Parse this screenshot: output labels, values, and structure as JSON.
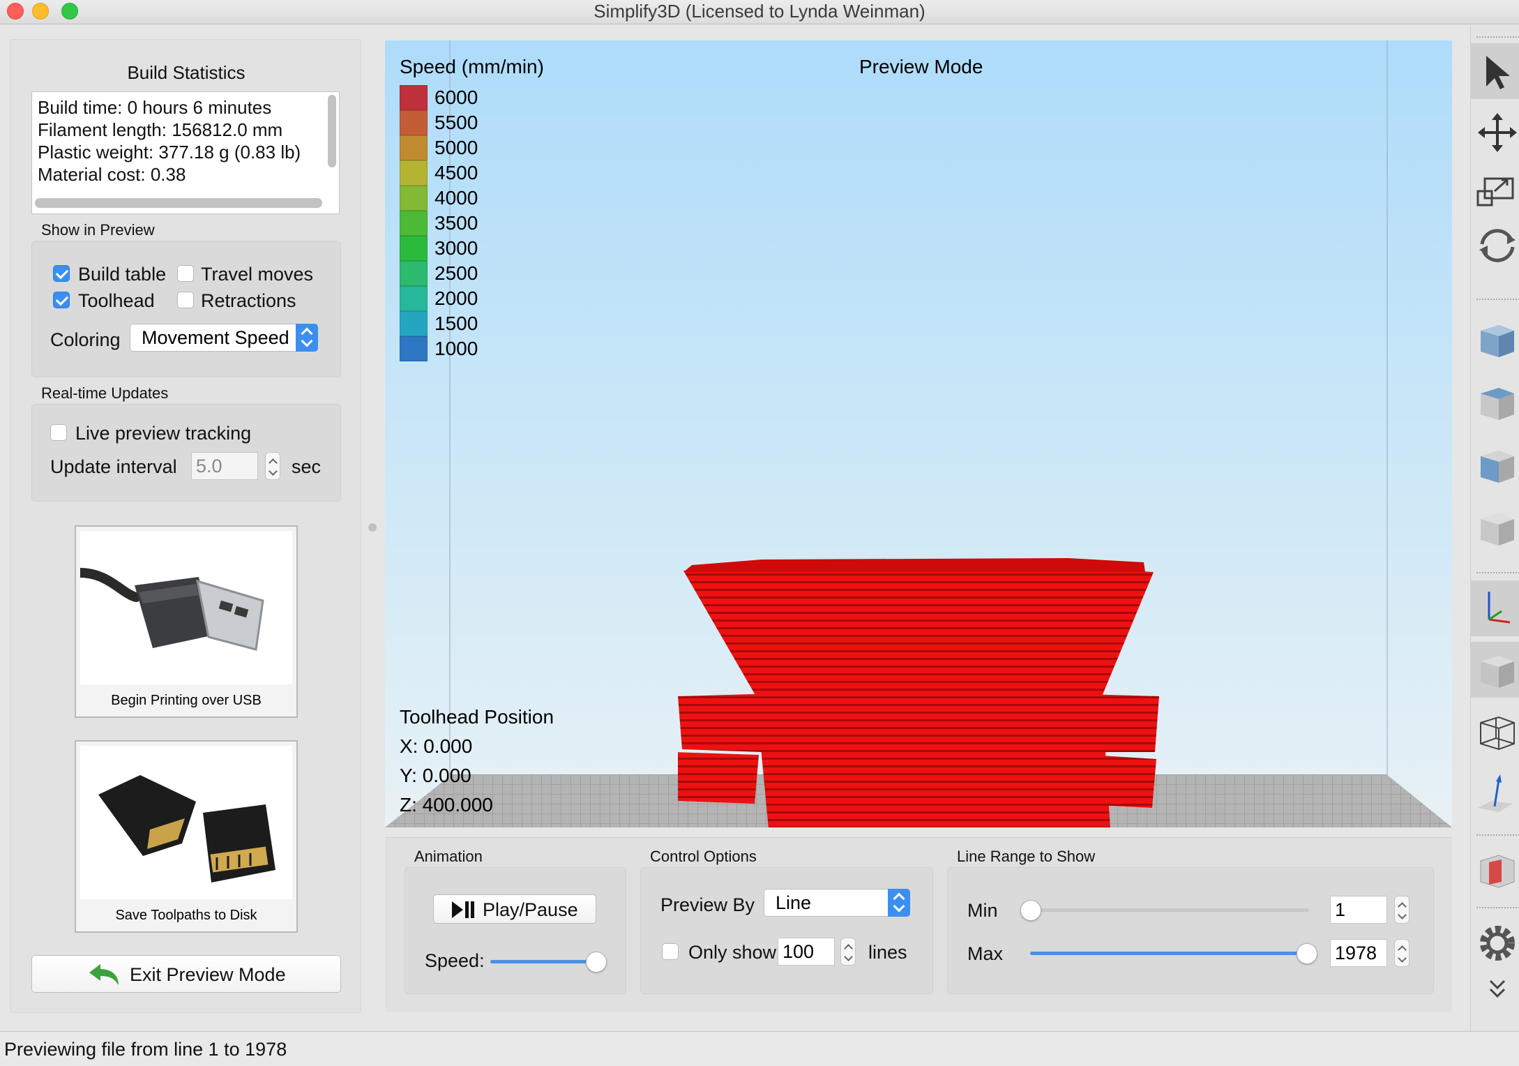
{
  "window": {
    "title": "Simplify3D (Licensed to Lynda Weinman)"
  },
  "build_stats": {
    "heading": "Build Statistics",
    "lines": [
      "Build time: 0 hours 6 minutes",
      "Filament length: 156812.0 mm",
      "Plastic weight: 377.18 g (0.83 lb)",
      "Material cost: 0.38"
    ]
  },
  "show_in_preview": {
    "heading": "Show in Preview",
    "build_table": {
      "label": "Build table",
      "checked": true
    },
    "travel_moves": {
      "label": "Travel moves",
      "checked": false
    },
    "toolhead": {
      "label": "Toolhead",
      "checked": true
    },
    "retractions": {
      "label": "Retractions",
      "checked": false
    },
    "coloring_label": "Coloring",
    "coloring_value": "Movement Speed"
  },
  "realtime": {
    "heading": "Real-time Updates",
    "live_tracking": {
      "label": "Live preview tracking",
      "checked": false
    },
    "interval_label": "Update interval",
    "interval_value": "5.0",
    "interval_unit": "sec"
  },
  "actions": {
    "usb_caption": "Begin Printing over USB",
    "disk_caption": "Save Toolpaths to Disk",
    "exit_label": "Exit Preview Mode"
  },
  "viewport": {
    "legend_title": "Speed (mm/min)",
    "mode_title": "Preview Mode",
    "legend": [
      {
        "value": "6000",
        "color": "#c0303a"
      },
      {
        "value": "5500",
        "color": "#c45c38"
      },
      {
        "value": "5000",
        "color": "#c08a30"
      },
      {
        "value": "4500",
        "color": "#b5b432"
      },
      {
        "value": "4000",
        "color": "#82b935"
      },
      {
        "value": "3500",
        "color": "#4cba34"
      },
      {
        "value": "3000",
        "color": "#2cba3d"
      },
      {
        "value": "2500",
        "color": "#2bba6e"
      },
      {
        "value": "2000",
        "color": "#27b79a"
      },
      {
        "value": "1500",
        "color": "#25a6c0"
      },
      {
        "value": "1000",
        "color": "#2d77c4"
      }
    ],
    "toolhead_title": "Toolhead Position",
    "toolhead_x": "X: 0.000",
    "toolhead_y": "Y: 0.000",
    "toolhead_z": "Z: 400.000",
    "model_color": "#ee1111"
  },
  "animation": {
    "heading": "Animation",
    "play_label": "Play/Pause",
    "speed_label": "Speed:",
    "speed_level": 0.95
  },
  "control_options": {
    "heading": "Control Options",
    "preview_by_label": "Preview By",
    "preview_by_value": "Line",
    "only_show": {
      "label": "Only show",
      "checked": false
    },
    "only_show_value": "100",
    "lines_label": "lines"
  },
  "line_range": {
    "heading": "Line Range to Show",
    "min_label": "Min",
    "min_value": "1",
    "max_label": "Max",
    "max_value": "1978"
  },
  "statusbar": {
    "text": "Previewing file from line 1 to 1978"
  },
  "toolbar": {
    "tools": [
      "select-arrow-icon",
      "move-icon",
      "scale-icon",
      "rotate-icon",
      "view-iso-cube-icon",
      "view-top-cube-icon",
      "view-front-cube-icon",
      "view-side-cube-icon",
      "axes-icon",
      "solid-cube-icon",
      "wireframe-cube-icon",
      "normals-icon",
      "cross-section-icon",
      "settings-gear-icon",
      "expand-chevron-icon"
    ]
  }
}
